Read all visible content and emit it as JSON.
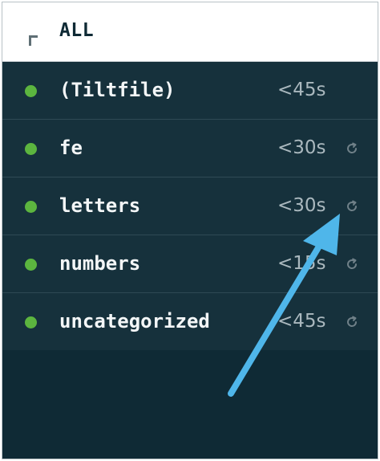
{
  "header": {
    "label": "ALL",
    "icon": "corner-bracket-icon"
  },
  "resources": [
    {
      "name": "(Tiltfile)",
      "time": "<45s",
      "status_color": "#5cb53f",
      "has_reload": false
    },
    {
      "name": "fe",
      "time": "<30s",
      "status_color": "#5cb53f",
      "has_reload": true
    },
    {
      "name": "letters",
      "time": "<30s",
      "status_color": "#5cb53f",
      "has_reload": true
    },
    {
      "name": "numbers",
      "time": "<15s",
      "status_color": "#5cb53f",
      "has_reload": true
    },
    {
      "name": "uncategorized",
      "time": "<45s",
      "status_color": "#5cb53f",
      "has_reload": true
    }
  ],
  "colors": {
    "panel_bg": "#0f2a35",
    "row_bg": "#16313c",
    "status_ok": "#5cb53f",
    "arrow": "#4fb6ea"
  }
}
